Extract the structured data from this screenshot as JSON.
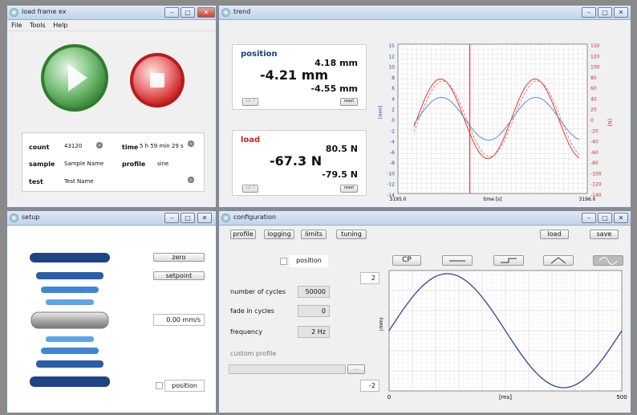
{
  "load_frame": {
    "title": "load frame ex",
    "menu": [
      "File",
      "Tools",
      "Help"
    ],
    "count_label": "count",
    "count_value": "43120",
    "time_label": "time",
    "time_value": "5 h 59 min 29 s",
    "sample_label": "sample",
    "sample_value": "Sample Name",
    "profile_label": "profile",
    "profile_value": "sine",
    "test_label": "test",
    "test_value": "Test Name"
  },
  "trend": {
    "title": "trend",
    "position": {
      "label": "position",
      "main": "-4.21 mm",
      "max": "4.18 mm",
      "min": "-4.55 mm",
      "set_label": "set 0",
      "reset_label": "reset"
    },
    "load": {
      "label": "load",
      "main": "-67.3 N",
      "max": "80.5 N",
      "min": "-79.5 N",
      "set_label": "set 0",
      "reset_label": "reset"
    },
    "chart_data": {
      "type": "line",
      "xlabel": "time [s]",
      "ylabel_left": "[mm]",
      "ylabel_right": "[N]",
      "x_ticks": [
        "3195.0",
        "3196.0"
      ],
      "y_left_ticks": [
        "15",
        "12",
        "10",
        "8",
        "6",
        "4",
        "2",
        "0",
        "-2",
        "-4",
        "-6",
        "-8",
        "-10",
        "-12",
        "-14"
      ],
      "y_right_ticks": [
        "150",
        "120",
        "100",
        "80",
        "60",
        "40",
        "20",
        "0",
        "-20",
        "-40",
        "-60",
        "-80",
        "-100",
        "-120",
        "-140"
      ],
      "ylim_left": [
        -15,
        15
      ],
      "ylim_right": [
        -150,
        150
      ],
      "cursor_x_fraction": 0.38,
      "series": [
        {
          "values_desc": "position",
          "amp": 4.3,
          "color": "#5a8fd6"
        },
        {
          "values_desc": "load",
          "amp": 80,
          "color": "#e03a3a"
        }
      ]
    }
  },
  "setup": {
    "title": "setup",
    "zero_label": "zero",
    "setpoint_label": "setpoint",
    "speed_value": "0.00 mm/s",
    "position_label": "position"
  },
  "configuration": {
    "title": "configuration",
    "tabs": [
      "profile",
      "logging",
      "limits",
      "tuning"
    ],
    "load_label": "load",
    "save_label": "save",
    "position_label": "position",
    "cp_label": "CP",
    "cycles_label": "number of cycles",
    "cycles_value": "50000",
    "fade_label": "fade in cycles",
    "fade_value": "0",
    "freq_label": "frequency",
    "freq_value": "2 Hz",
    "custom_label": "custom profile",
    "browse_label": "...",
    "ymax_value": "2",
    "ymin_value": "-2",
    "chart_data": {
      "type": "line",
      "xlabel": "[ms]",
      "ylabel": "[mm]",
      "x_ticks": [
        "0",
        "500"
      ],
      "xlim": [
        0,
        500
      ],
      "ylim": [
        -2,
        2
      ],
      "series": [
        {
          "function": "sine",
          "amplitude": 2,
          "period_ms": 500
        }
      ]
    }
  }
}
